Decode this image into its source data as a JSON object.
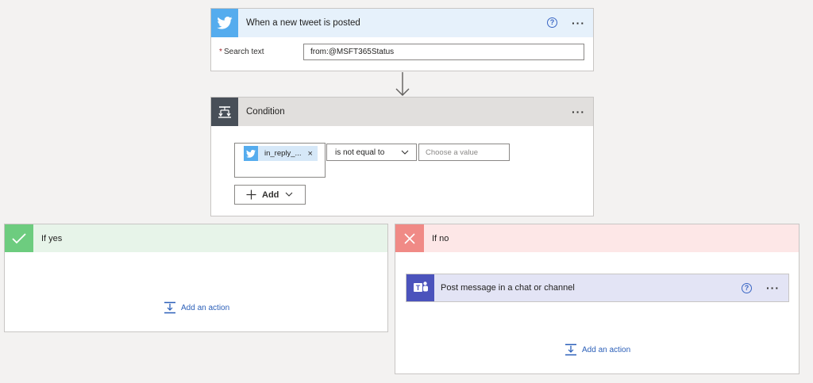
{
  "trigger": {
    "title": "When a new tweet is posted",
    "field_label": "Search text",
    "required_marker": "*",
    "field_value": "from:@MSFT365Status"
  },
  "condition": {
    "title": "Condition",
    "token_label": "in_reply_...",
    "token_remove": "×",
    "operator": "is not equal to",
    "value_placeholder": "Choose a value",
    "add_label": "Add"
  },
  "if_yes": {
    "title": "If yes",
    "add_action_label": "Add an action"
  },
  "if_no": {
    "title": "If no",
    "action_title": "Post message in a chat or channel",
    "add_action_label": "Add an action"
  },
  "icons": {
    "help": "?",
    "more": "···"
  },
  "colors": {
    "twitter": "#55acee",
    "condition_tile": "#484f58",
    "yes_tile": "#6dcc7f",
    "no_tile": "#f08a86",
    "teams": "#4b53bc",
    "link": "#2b5fb8"
  }
}
